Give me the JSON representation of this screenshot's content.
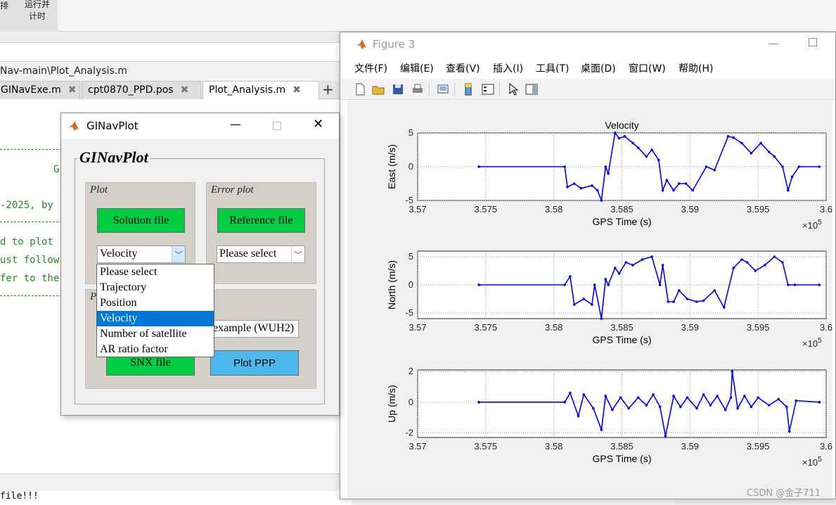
{
  "toolstrip": {
    "partial_label": "排",
    "run_timer_label_line1": "运行并",
    "run_timer_label_line2": "计时"
  },
  "editor": {
    "path": "Nav-main\\Plot_Analysis.m",
    "tabs": [
      {
        "label": "GINavExe.m",
        "close": "✖"
      },
      {
        "label": "cpt0870_PPD.pos",
        "close": "✖"
      },
      {
        "label": "Plot_Analysis.m",
        "close": "✖"
      }
    ],
    "add_tab": "+",
    "code_lines": [
      "G",
      "-2025, by",
      "d to plot",
      "ust follow",
      "fer to the"
    ],
    "cmd_text": "file!!!"
  },
  "figure": {
    "title": "Figure 3",
    "menu": [
      "文件(F)",
      "编辑(E)",
      "查看(V)",
      "插入(I)",
      "工具(T)",
      "桌面(D)",
      "窗口(W)",
      "帮助(H)"
    ],
    "toolbar_icons": [
      "new-figure-icon",
      "open-file-icon",
      "save-icon",
      "print-icon",
      "link-plot-icon",
      "insert-colorbar-icon",
      "insert-legend-icon",
      "edit-plot-arrow-icon",
      "property-inspector-icon"
    ]
  },
  "chart_data": [
    {
      "type": "line",
      "title": "Velocity",
      "xlabel": "GPS Time (s)",
      "ylabel": "East (m/s)",
      "x_multiplier": "×10^5",
      "xlim": [
        3.57,
        3.6
      ],
      "ylim": [
        -5,
        5
      ],
      "xticks": [
        "3.57",
        "3.575",
        "3.58",
        "3.585",
        "3.59",
        "3.595",
        "3.6"
      ],
      "yticks": [
        "-5",
        "0",
        "5"
      ],
      "grid": true,
      "color": "#0000ff",
      "x": [
        3.5745,
        3.5808,
        3.581,
        3.5815,
        3.582,
        3.5828,
        3.5832,
        3.5835,
        3.5838,
        3.584,
        3.5845,
        3.5848,
        3.5852,
        3.5858,
        3.5862,
        3.5868,
        3.5872,
        3.5877,
        3.588,
        3.5883,
        3.5888,
        3.5892,
        3.5897,
        3.5902,
        3.5912,
        3.5918,
        3.5928,
        3.5932,
        3.5938,
        3.5945,
        3.5952,
        3.5958,
        3.5962,
        3.5968,
        3.5972,
        3.5975,
        3.598,
        3.5995
      ],
      "y": [
        0,
        0,
        -3,
        -2.5,
        -3.2,
        -2.8,
        -3.5,
        -5,
        0,
        -1,
        5,
        4.2,
        4.5,
        3.5,
        2.8,
        1.5,
        2.5,
        1,
        -3.5,
        -2,
        -3.5,
        -2.5,
        -2.5,
        -3.5,
        0,
        -0.5,
        4.5,
        4.3,
        3.5,
        2,
        3.5,
        2.2,
        1.5,
        0,
        -3.5,
        -1.5,
        0,
        0
      ]
    },
    {
      "type": "line",
      "title": "",
      "xlabel": "GPS Time (s)",
      "ylabel": "North (m/s)",
      "x_multiplier": "×10^5",
      "xlim": [
        3.57,
        3.6
      ],
      "ylim": [
        -6,
        6
      ],
      "xticks": [
        "3.57",
        "3.575",
        "3.58",
        "3.585",
        "3.59",
        "3.595",
        "3.6"
      ],
      "yticks": [
        "-5",
        "0",
        "5"
      ],
      "grid": true,
      "color": "#0000ff",
      "x": [
        3.5745,
        3.5808,
        3.5812,
        3.5815,
        3.5822,
        3.5828,
        3.583,
        3.5835,
        3.5838,
        3.584,
        3.5845,
        3.5848,
        3.5853,
        3.5858,
        3.5865,
        3.5872,
        3.5878,
        3.588,
        3.5884,
        3.5888,
        3.5892,
        3.5898,
        3.5905,
        3.591,
        3.5918,
        3.5925,
        3.5932,
        3.5938,
        3.5942,
        3.5948,
        3.5955,
        3.5962,
        3.5968,
        3.5972,
        3.5977,
        3.5995
      ],
      "y": [
        0,
        0,
        1.5,
        -3.5,
        -2.5,
        -3.5,
        0,
        -6,
        1,
        0,
        3,
        2,
        4,
        3.5,
        4.5,
        5,
        0,
        3.5,
        -3,
        -3,
        -1,
        -2.5,
        -3,
        -2.8,
        -1,
        -4,
        3,
        4.5,
        4,
        2.5,
        3.5,
        5,
        4,
        0,
        0,
        0
      ]
    },
    {
      "type": "line",
      "title": "",
      "xlabel": "GPS Time (s)",
      "ylabel": "Up (m/s)",
      "x_multiplier": "×10^5",
      "xlim": [
        3.57,
        3.6
      ],
      "ylim": [
        -2.3,
        2.1
      ],
      "xticks": [
        "3.57",
        "3.575",
        "3.58",
        "3.585",
        "3.59",
        "3.595",
        "3.6"
      ],
      "yticks": [
        "-2",
        "0",
        "2"
      ],
      "grid": true,
      "color": "#0000ff",
      "x": [
        3.5745,
        3.5808,
        3.5812,
        3.5818,
        3.5822,
        3.5829,
        3.5835,
        3.5838,
        3.5843,
        3.5849,
        3.5855,
        3.5862,
        3.5868,
        3.5873,
        3.5878,
        3.5882,
        3.5888,
        3.5893,
        3.5898,
        3.5905,
        3.591,
        3.5915,
        3.592,
        3.5926,
        3.593,
        3.5931,
        3.5935,
        3.594,
        3.5945,
        3.595,
        3.5958,
        3.5965,
        3.5971,
        3.5973,
        3.5978,
        3.5995
      ],
      "y": [
        0,
        0,
        0.6,
        -0.9,
        0.5,
        -0.4,
        -1.8,
        0.4,
        -0.5,
        0.3,
        -0.4,
        0.3,
        -0.2,
        0.5,
        -0.3,
        -2.2,
        0.4,
        -0.3,
        0.3,
        -0.4,
        0.5,
        -0.2,
        0.4,
        -0.5,
        0.3,
        2.0,
        -0.4,
        0.4,
        -0.3,
        0.3,
        -0.2,
        0.2,
        -0.3,
        -1.9,
        0.1,
        0
      ]
    }
  ],
  "dialog": {
    "title": "GINavPlot",
    "heading": "GINavPlot",
    "plot_panel": {
      "title": "Plot",
      "solution_btn": "Solution file",
      "select_value": "Velocity"
    },
    "error_panel": {
      "title": "Error plot",
      "reference_btn": "Reference file",
      "select_value": "Please select"
    },
    "ppp_panel": {
      "title_partial": "P",
      "example_text": "example (WUH2)",
      "snx_btn": "SNX file",
      "plot_ppp_btn": "Plot PPP"
    },
    "dropdown_options": [
      "Please select",
      "Trajectory",
      "Position",
      "Velocity",
      "Number of satellite",
      "AR ratio factor"
    ],
    "dropdown_selected_index": 3
  },
  "watermark": "CSDN @金子711"
}
